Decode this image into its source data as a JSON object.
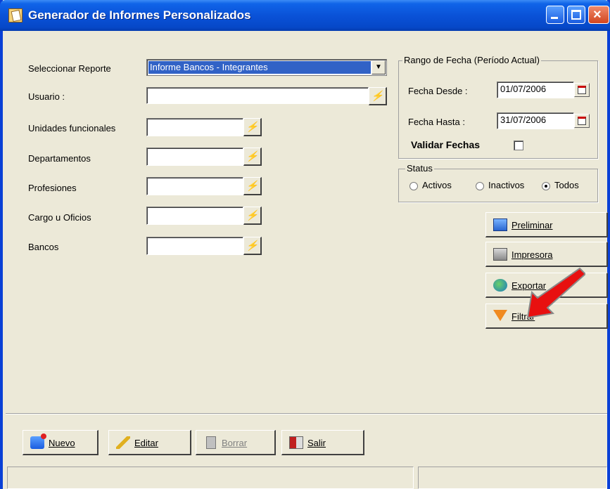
{
  "window": {
    "title": "Generador de Informes Personalizados"
  },
  "form": {
    "report_label": "Seleccionar Reporte",
    "report_value": "Informe Bancos - Integrantes",
    "user_label": "Usuario :",
    "user_value": "",
    "fields": [
      {
        "label": "Unidades funcionales",
        "value": ""
      },
      {
        "label": "Departamentos",
        "value": ""
      },
      {
        "label": "Profesiones",
        "value": ""
      },
      {
        "label": "Cargo u Oficios",
        "value": ""
      },
      {
        "label": "Bancos",
        "value": ""
      }
    ]
  },
  "date_range": {
    "legend": "Rango de Fecha (Período Actual)",
    "from_label": "Fecha Desde :",
    "from_value": "01/07/2006",
    "to_label": "Fecha Hasta :",
    "to_value": "31/07/2006",
    "validate_label": "Validar Fechas",
    "validate_checked": false
  },
  "status": {
    "legend": "Status",
    "options": [
      "Activos",
      "Inactivos",
      "Todos"
    ],
    "selected": "Todos"
  },
  "actions": {
    "preview": "Preliminar",
    "printer": "Impresora",
    "export": "Exportar",
    "filter": "Filtrar"
  },
  "footer": {
    "new": "Nuevo",
    "edit": "Editar",
    "delete": "Borrar",
    "exit": "Salir"
  },
  "colors": {
    "titlebar": "#0a52d8",
    "selection": "#3162c6",
    "arrow": "#e81010",
    "face": "#ece9d8"
  }
}
